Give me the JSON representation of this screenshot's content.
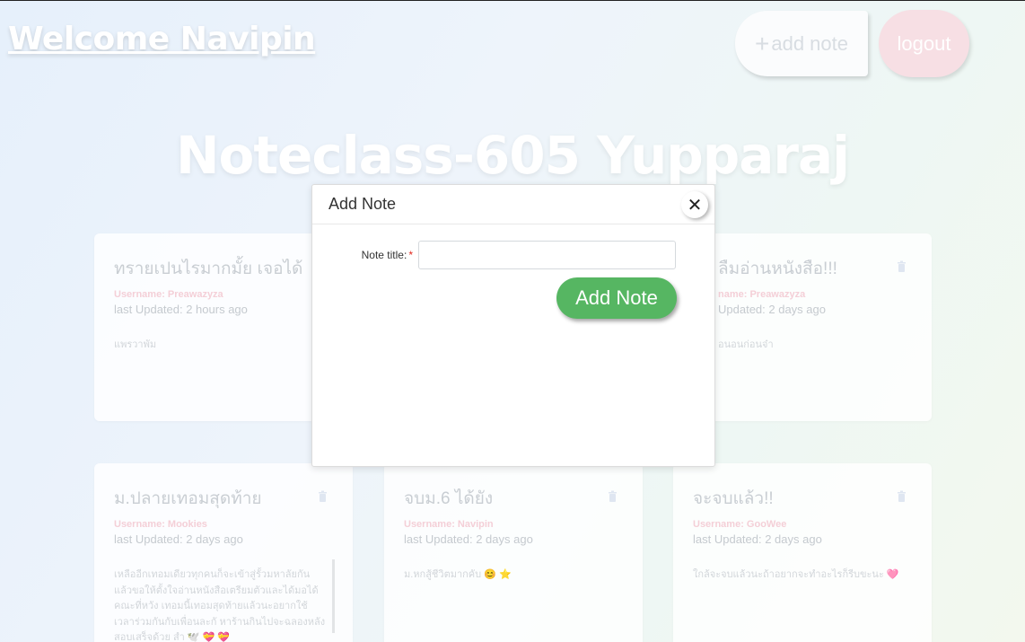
{
  "header": {
    "welcome": "Welcome Navipin",
    "add_note_plus": "+",
    "add_note_label": "add note",
    "logout_label": "logout"
  },
  "hero": {
    "title": "Noteclass-605 Yupparaj"
  },
  "notes": [
    {
      "title": "ทรายเปนไรมากมั้ย เจอได้",
      "username": "Username: Preawazyza",
      "updated": "last Updated: 2 hours ago",
      "body": "แพรวาพัม"
    },
    {
      "title": "ลืมอ่านหนังสือ!!!",
      "username": "name: Preawazyza",
      "updated": "Updated: 2 days ago",
      "body": "อนอนก่อนจ๋า"
    },
    {
      "title": "ม.ปลายเทอมสุดท้าย",
      "username": "Username: Mookies",
      "updated": "last Updated: 2 days ago",
      "body": "เหลืออีกเทอมเดียวทุกคนก็จะเข้าสู่รั้วมหาลัยกันแล้วขอให้ตั้งใจอ่านหนังสือเตรียมตัวและได้มอได้คณะที่หวัง เทอมนี้เทอมสุดท้ายแล้วนะอยากใช้เวลาร่วมกันกับเพื่อนละกั หาร้านกินไปจะฉลองหลังสอบเสร็จด้วย สำ 🕊️ 💝 💝"
    },
    {
      "title": "จบม.6 ได้ยัง",
      "username": "Username: Navipin",
      "updated": "last Updated: 2 days ago",
      "body": "ม.หกสู้ชีวิตมากคับ 😊 ⭐"
    },
    {
      "title": "จะจบแล้ว!!",
      "username": "Username: GooWee",
      "updated": "last Updated: 2 days ago",
      "body": "ใกล้จะจบแล้วนะถ้าอยากจะทำอะไรก็รีบขะนะ 🩷"
    }
  ],
  "modal": {
    "title": "Add Note",
    "close_glyph": "✕",
    "field_label": "Note title:",
    "required_mark": "*",
    "input_value": "",
    "input_placeholder": "",
    "submit_label": "Add Note"
  },
  "colors": {
    "submit": "#56b662",
    "username": "#f4cfd7",
    "logout": "#f7dfe4"
  }
}
